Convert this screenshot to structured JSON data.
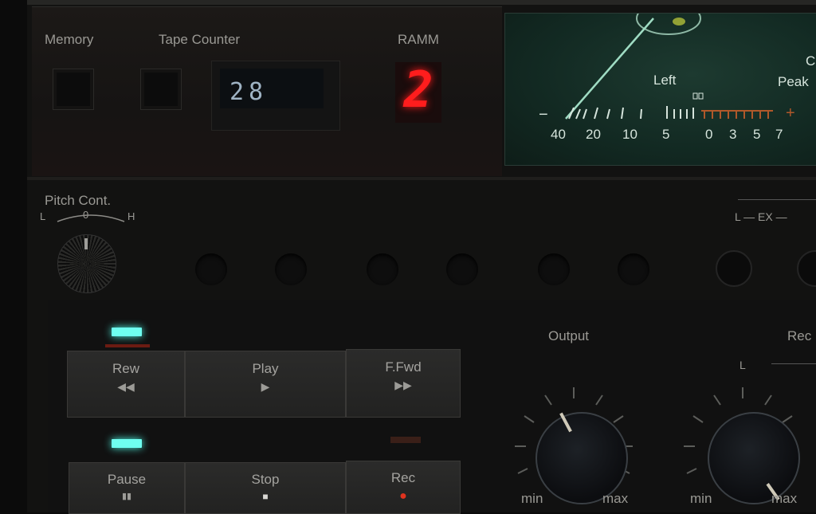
{
  "top": {
    "memory_label": "Memory",
    "tape_counter_label": "Tape Counter",
    "tape_counter_value": "28",
    "ramm_label": "RAMM",
    "ramm_value": "2"
  },
  "meter": {
    "channel_label": "Left",
    "peak_label": "Peak",
    "peak_prefix": "C",
    "minus_sign": "−",
    "plus_sign": "+",
    "scale": [
      "40",
      "20",
      "10",
      "5",
      "0",
      "3",
      "5",
      "7"
    ]
  },
  "pitch": {
    "label": "Pitch Cont.",
    "low": "L",
    "zero": "0",
    "high": "H"
  },
  "ex_label": "L — EX —",
  "transport": {
    "rew": {
      "label": "Rew",
      "icon": "◀◀"
    },
    "play": {
      "label": "Play",
      "icon": "▶"
    },
    "ffwd": {
      "label": "F.Fwd",
      "icon": "▶▶"
    },
    "pause": {
      "label": "Pause",
      "icon": "▮▮"
    },
    "stop": {
      "label": "Stop",
      "icon": "■"
    },
    "rec": {
      "label": "Rec",
      "icon": "●"
    }
  },
  "output": {
    "label": "Output",
    "min": "min",
    "max": "max"
  },
  "rec_level": {
    "label": "Rec",
    "channel": "L",
    "min": "min",
    "max": "max"
  },
  "colors": {
    "led_cyan": "#6ffff0",
    "ramm_red": "#ff1d1d",
    "meter_green": "#d6e4dc",
    "peak_orange": "#b0582a"
  }
}
